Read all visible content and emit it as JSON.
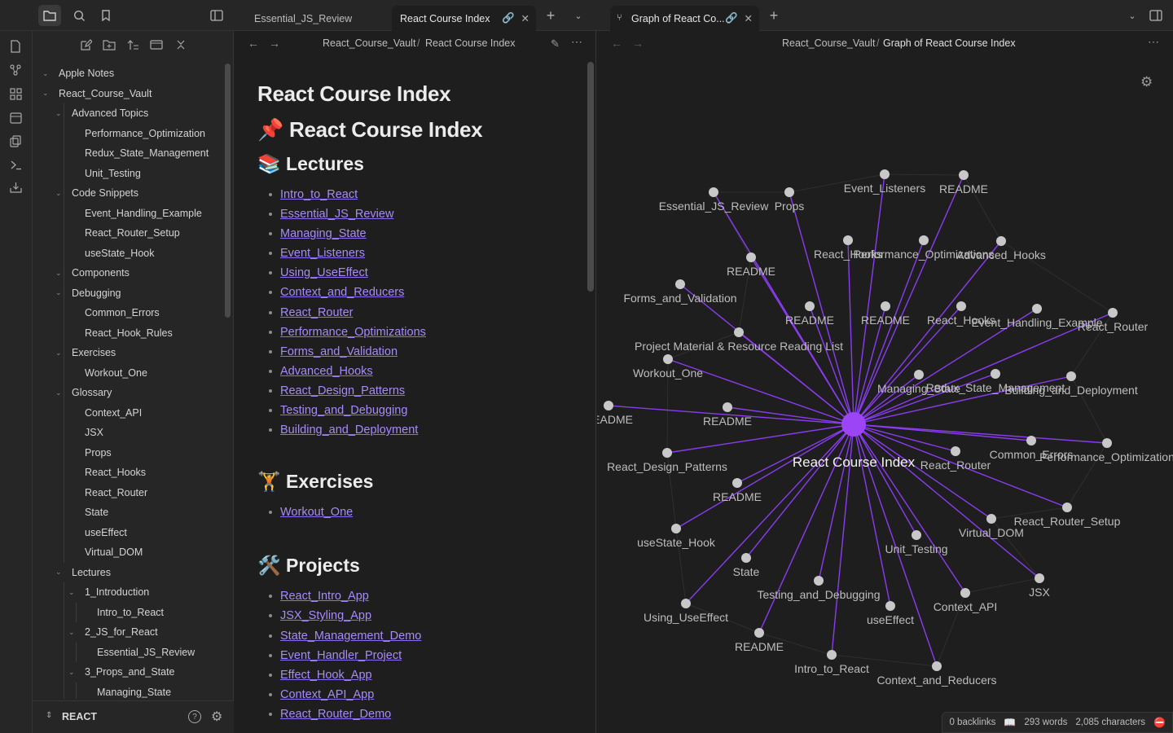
{
  "tabs": [
    {
      "label": "Essential_JS_Review"
    },
    {
      "label": "React Course Index"
    },
    {
      "label": "Graph of React Co..."
    }
  ],
  "sidebar": {
    "vault_name": "REACT",
    "tree": [
      {
        "label": "Apple Notes",
        "depth": 0,
        "folder": true
      },
      {
        "label": "React_Course_Vault",
        "depth": 0,
        "folder": true
      },
      {
        "label": "Advanced Topics",
        "depth": 1,
        "folder": true
      },
      {
        "label": "Performance_Optimization",
        "depth": 2
      },
      {
        "label": "Redux_State_Management",
        "depth": 2
      },
      {
        "label": "Unit_Testing",
        "depth": 2
      },
      {
        "label": "Code Snippets",
        "depth": 1,
        "folder": true
      },
      {
        "label": "Event_Handling_Example",
        "depth": 2
      },
      {
        "label": "React_Router_Setup",
        "depth": 2
      },
      {
        "label": "useState_Hook",
        "depth": 2
      },
      {
        "label": "Components",
        "depth": 1,
        "folder": true
      },
      {
        "label": "Debugging",
        "depth": 1,
        "folder": true
      },
      {
        "label": "Common_Errors",
        "depth": 2
      },
      {
        "label": "React_Hook_Rules",
        "depth": 2
      },
      {
        "label": "Exercises",
        "depth": 1,
        "folder": true
      },
      {
        "label": "Workout_One",
        "depth": 2
      },
      {
        "label": "Glossary",
        "depth": 1,
        "folder": true
      },
      {
        "label": "Context_API",
        "depth": 2
      },
      {
        "label": "JSX",
        "depth": 2
      },
      {
        "label": "Props",
        "depth": 2
      },
      {
        "label": "React_Hooks",
        "depth": 2
      },
      {
        "label": "React_Router",
        "depth": 2
      },
      {
        "label": "State",
        "depth": 2
      },
      {
        "label": "useEffect",
        "depth": 2
      },
      {
        "label": "Virtual_DOM",
        "depth": 2
      },
      {
        "label": "Lectures",
        "depth": 1,
        "folder": true
      },
      {
        "label": "1_Introduction",
        "depth": 2,
        "folder": true
      },
      {
        "label": "Intro_to_React",
        "depth": 3
      },
      {
        "label": "2_JS_for_React",
        "depth": 2,
        "folder": true
      },
      {
        "label": "Essential_JS_Review",
        "depth": 3
      },
      {
        "label": "3_Props_and_State",
        "depth": 2,
        "folder": true
      },
      {
        "label": "Managing_State",
        "depth": 3
      }
    ]
  },
  "editor": {
    "breadcrumb_vault": "React_Course_Vault",
    "breadcrumb_sep": "/",
    "breadcrumb_note": "React Course Index",
    "title": "React Course Index",
    "heading_pin": "📌 React Course Index",
    "lectures_heading": "📚 Lectures",
    "lectures": [
      "Intro_to_React",
      "Essential_JS_Review",
      "Managing_State",
      "Event_Listeners",
      "Using_UseEffect",
      "Context_and_Reducers",
      "React_Router",
      "Performance_Optimizations",
      "Forms_and_Validation",
      "Advanced_Hooks",
      "React_Design_Patterns",
      "Testing_and_Debugging",
      "Building_and_Deployment"
    ],
    "exercises_heading": "🏋️ Exercises",
    "exercises": [
      "Workout_One"
    ],
    "projects_heading": "🛠️ Projects",
    "projects": [
      "React_Intro_App",
      "JSX_Styling_App",
      "State_Management_Demo",
      "Event_Handler_Project",
      "Effect_Hook_App",
      "Context_API_App",
      "React_Router_Demo"
    ]
  },
  "graph": {
    "breadcrumb_vault": "React_Course_Vault",
    "breadcrumb_sep": "/",
    "breadcrumb_note": "Graph of React Course Index",
    "center_label": "React Course Index",
    "nodes": [
      "Essential_JS_Review",
      "Props",
      "Event_Listeners",
      "README",
      "README",
      "React_Hooks",
      "Performance_Optimizations",
      "Advanced_Hooks",
      "Forms_and_Validation",
      "README",
      "README",
      "React_Hooks",
      "Event_Handling_Example",
      "React_Router",
      "Project Material & Resource Reading List",
      "Workout_One",
      "Managing_State",
      "Redux_State_Management",
      "Building_and_Deployment",
      "README",
      "README",
      "React_Design_Patterns",
      "Common_Errors",
      "Performance_Optimization",
      "React_Router",
      "README",
      "React_Router_Setup",
      "useState_Hook",
      "Virtual_DOM",
      "Unit_Testing",
      "State",
      "JSX",
      "Testing_and_Debugging",
      "Context_API",
      "Using_UseEffect",
      "useEffect",
      "README",
      "Intro_to_React",
      "Context_and_Reducers"
    ],
    "accent": "#8b3cf0"
  },
  "status": {
    "backlinks": "0 backlinks",
    "words": "293 words",
    "characters": "2,085 characters"
  }
}
